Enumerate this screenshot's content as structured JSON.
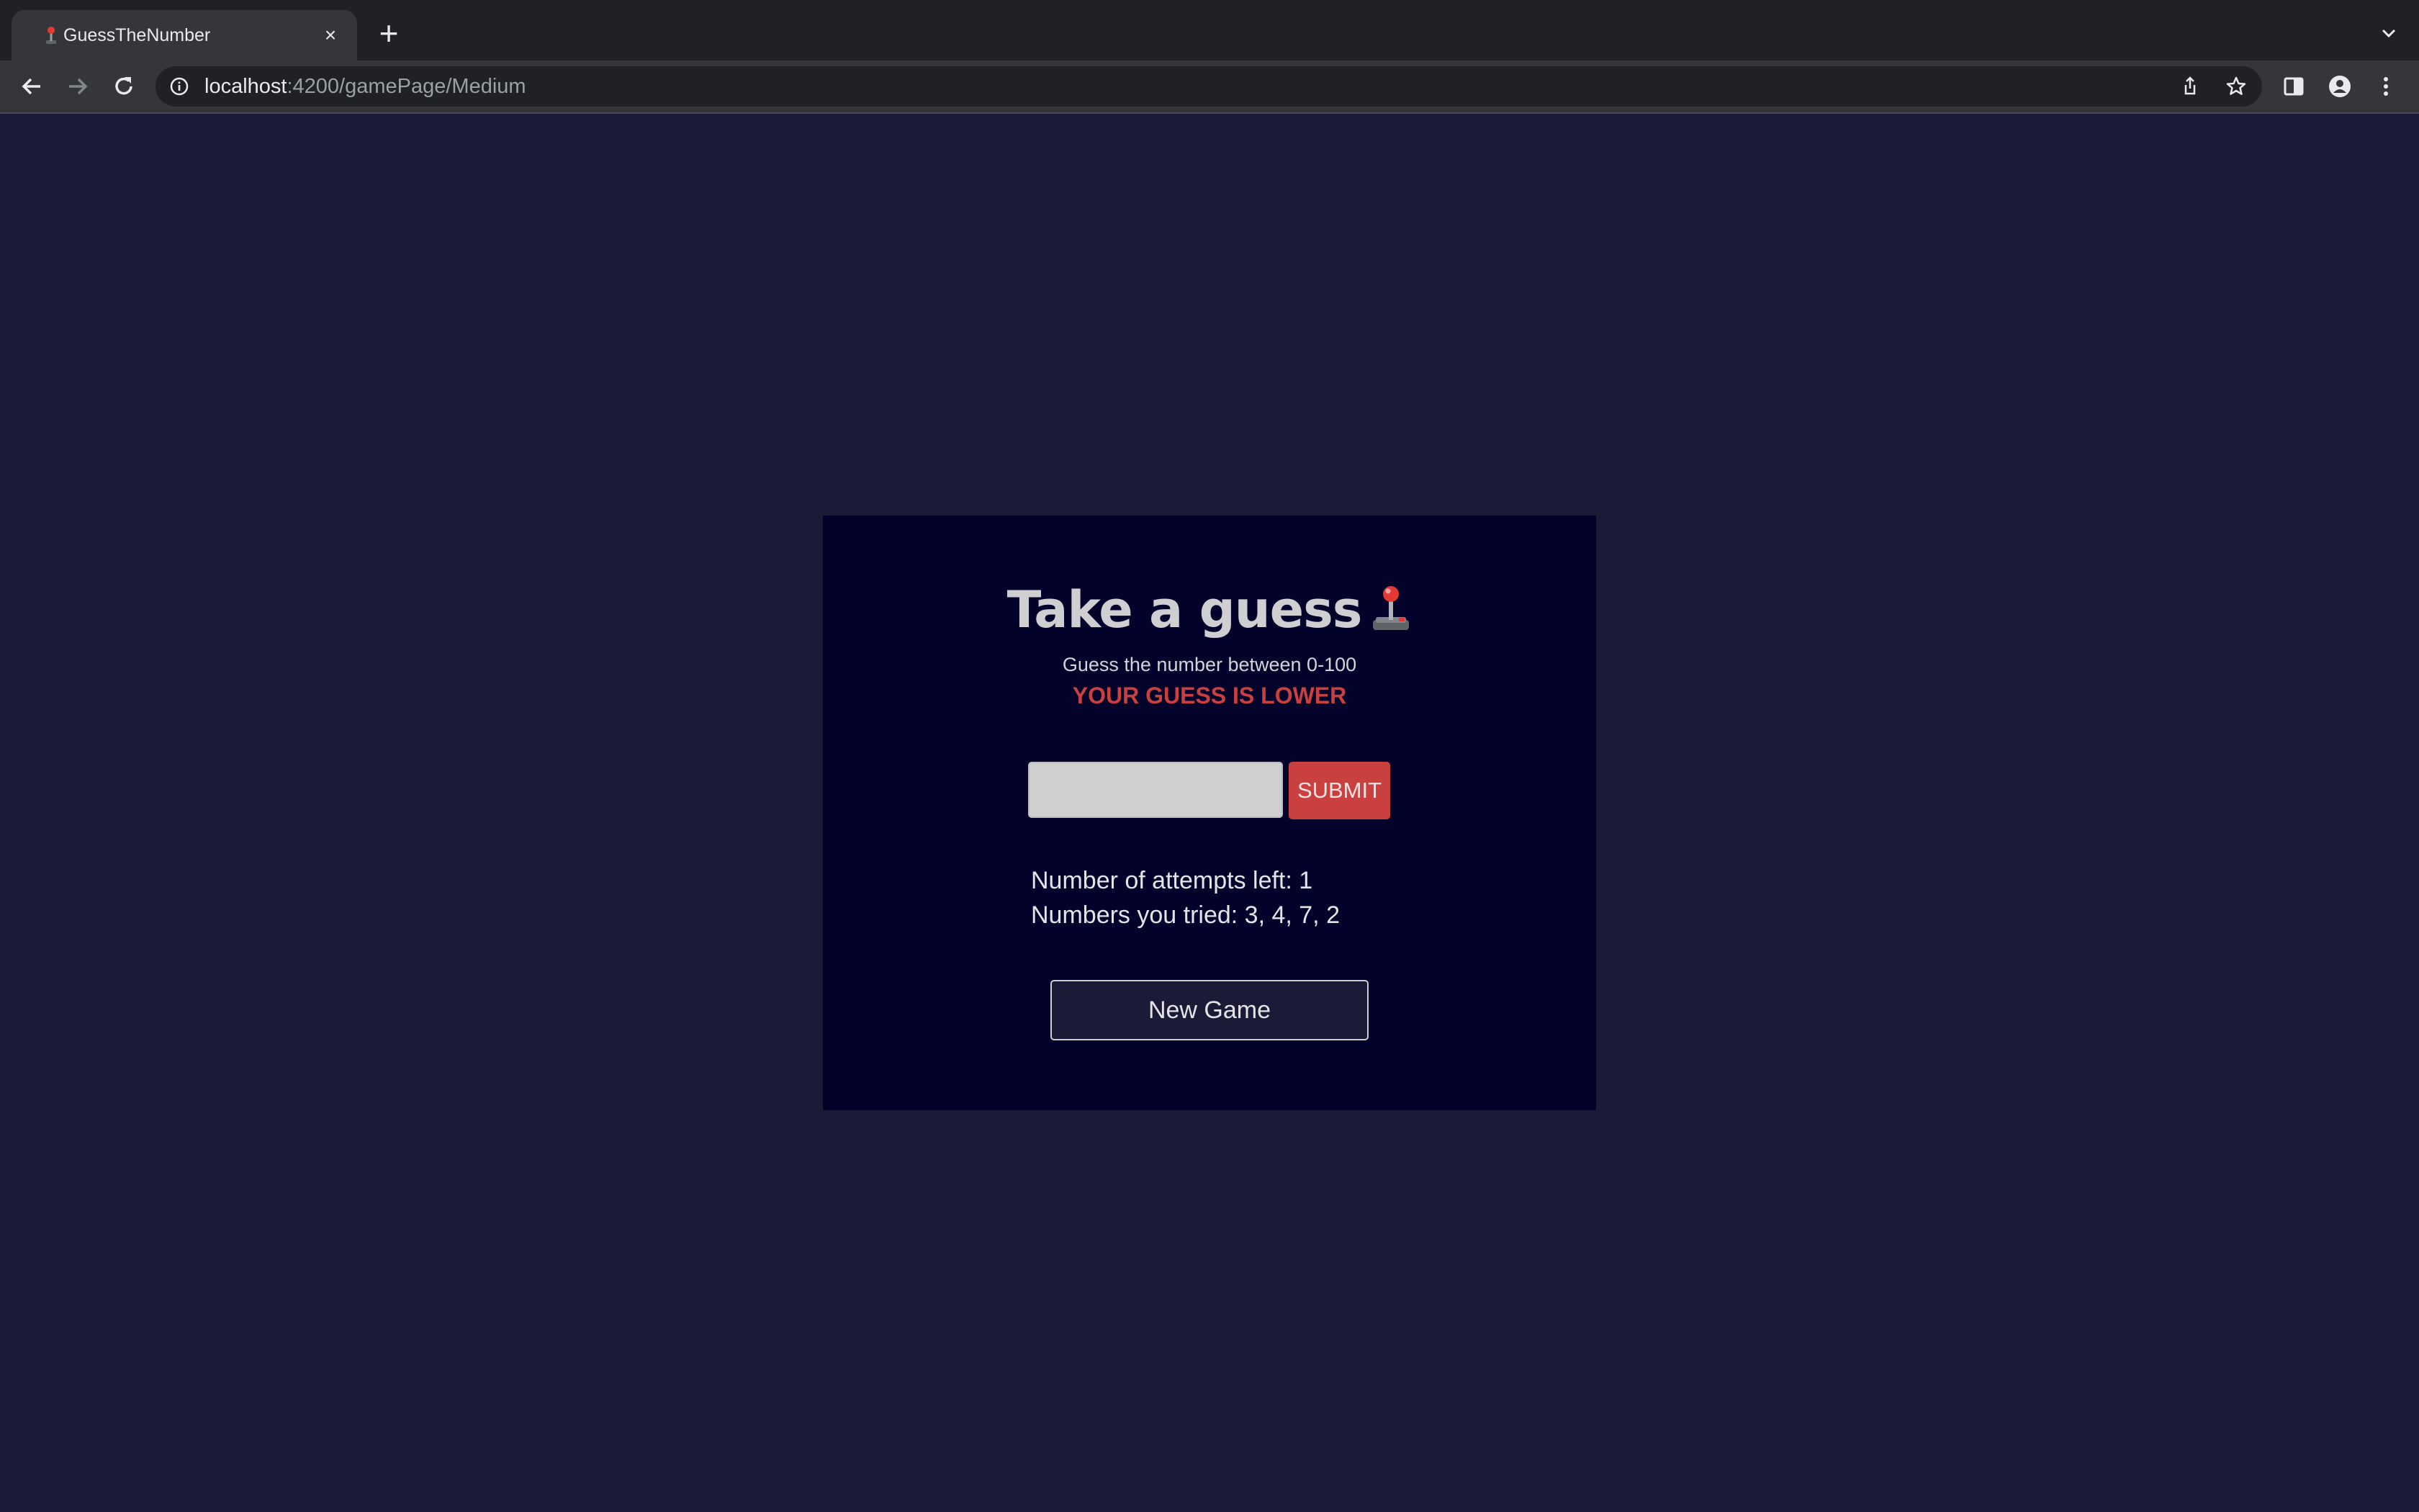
{
  "browser": {
    "tab_title": "GuessTheNumber",
    "tab_close": "×",
    "new_tab": "+",
    "url_host": "localhost",
    "url_path": ":4200/gamePage/Medium"
  },
  "game": {
    "title": "Take a guess",
    "title_icon": "joystick-icon",
    "subtitle": "Guess the number between 0-100",
    "feedback": "YOUR GUESS IS LOWER",
    "input_value": "",
    "submit_label": "SUBMIT",
    "attempts_text": "Number of attempts left: 1",
    "tried_text": "Numbers you tried: 3, 4, 7, 2",
    "new_game_label": "New Game"
  },
  "colors": {
    "page_background": "#1b1a37",
    "card_background": "#03022a",
    "accent_red": "#c9403f"
  }
}
